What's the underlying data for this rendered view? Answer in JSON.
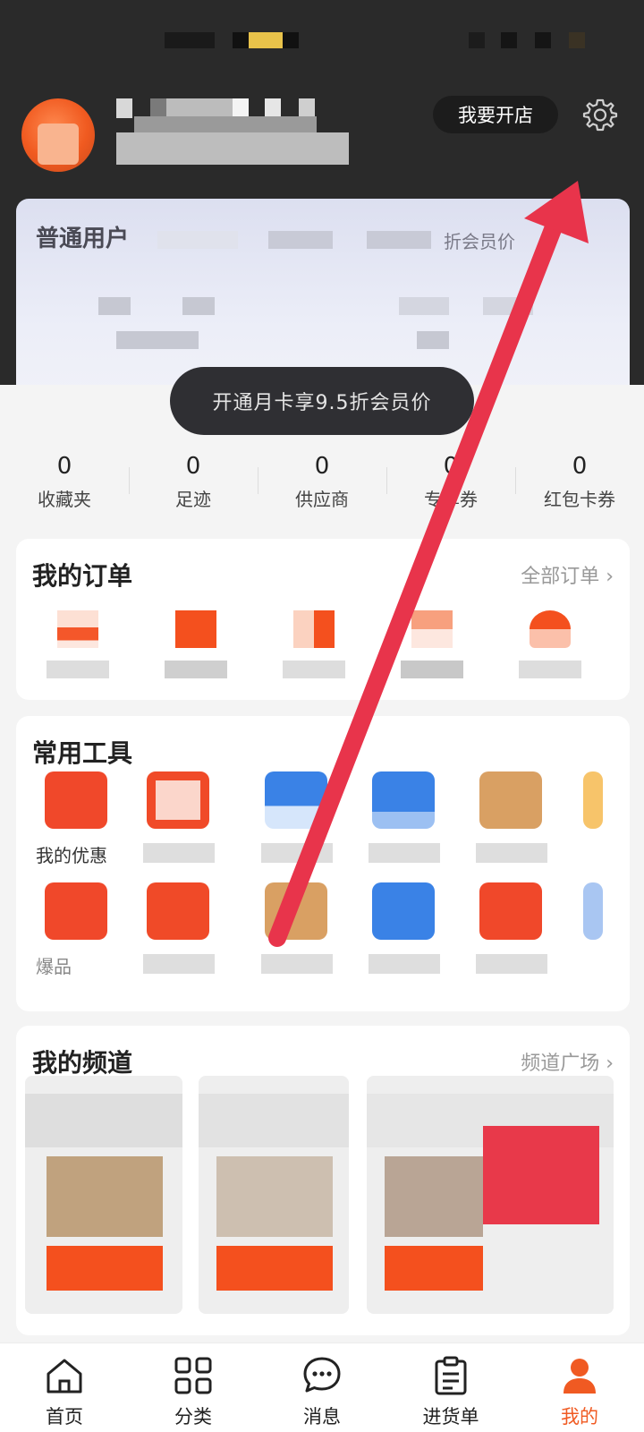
{
  "header": {
    "open_store_label": "我要开店",
    "settings_icon": "gear-icon"
  },
  "member": {
    "level_label": "普通用户",
    "price_note": "折会员价",
    "vip_offer": "开通月卡享9.5折会员价"
  },
  "stats": [
    {
      "count": "0",
      "label": "收藏夹"
    },
    {
      "count": "0",
      "label": "足迹"
    },
    {
      "count": "0",
      "label": "供应商"
    },
    {
      "count": "0",
      "label": "专享券"
    },
    {
      "count": "0",
      "label": "红包卡券"
    }
  ],
  "orders": {
    "title": "我的订单",
    "all_link": "全部订单 ›"
  },
  "tools": {
    "title": "常用工具",
    "first_label": "我的优惠",
    "second_row_label": "爆品"
  },
  "channels": {
    "title": "我的频道",
    "plaza_link": "频道广场 ›"
  },
  "nav": [
    {
      "label": "首页",
      "icon": "home-icon"
    },
    {
      "label": "分类",
      "icon": "category-icon"
    },
    {
      "label": "消息",
      "icon": "message-icon"
    },
    {
      "label": "进货单",
      "icon": "clipboard-icon"
    },
    {
      "label": "我的",
      "icon": "profile-icon"
    }
  ],
  "colors": {
    "accent": "#f05a22",
    "header_bg": "#2a2a2a",
    "annotation_arrow": "#e8344b"
  }
}
